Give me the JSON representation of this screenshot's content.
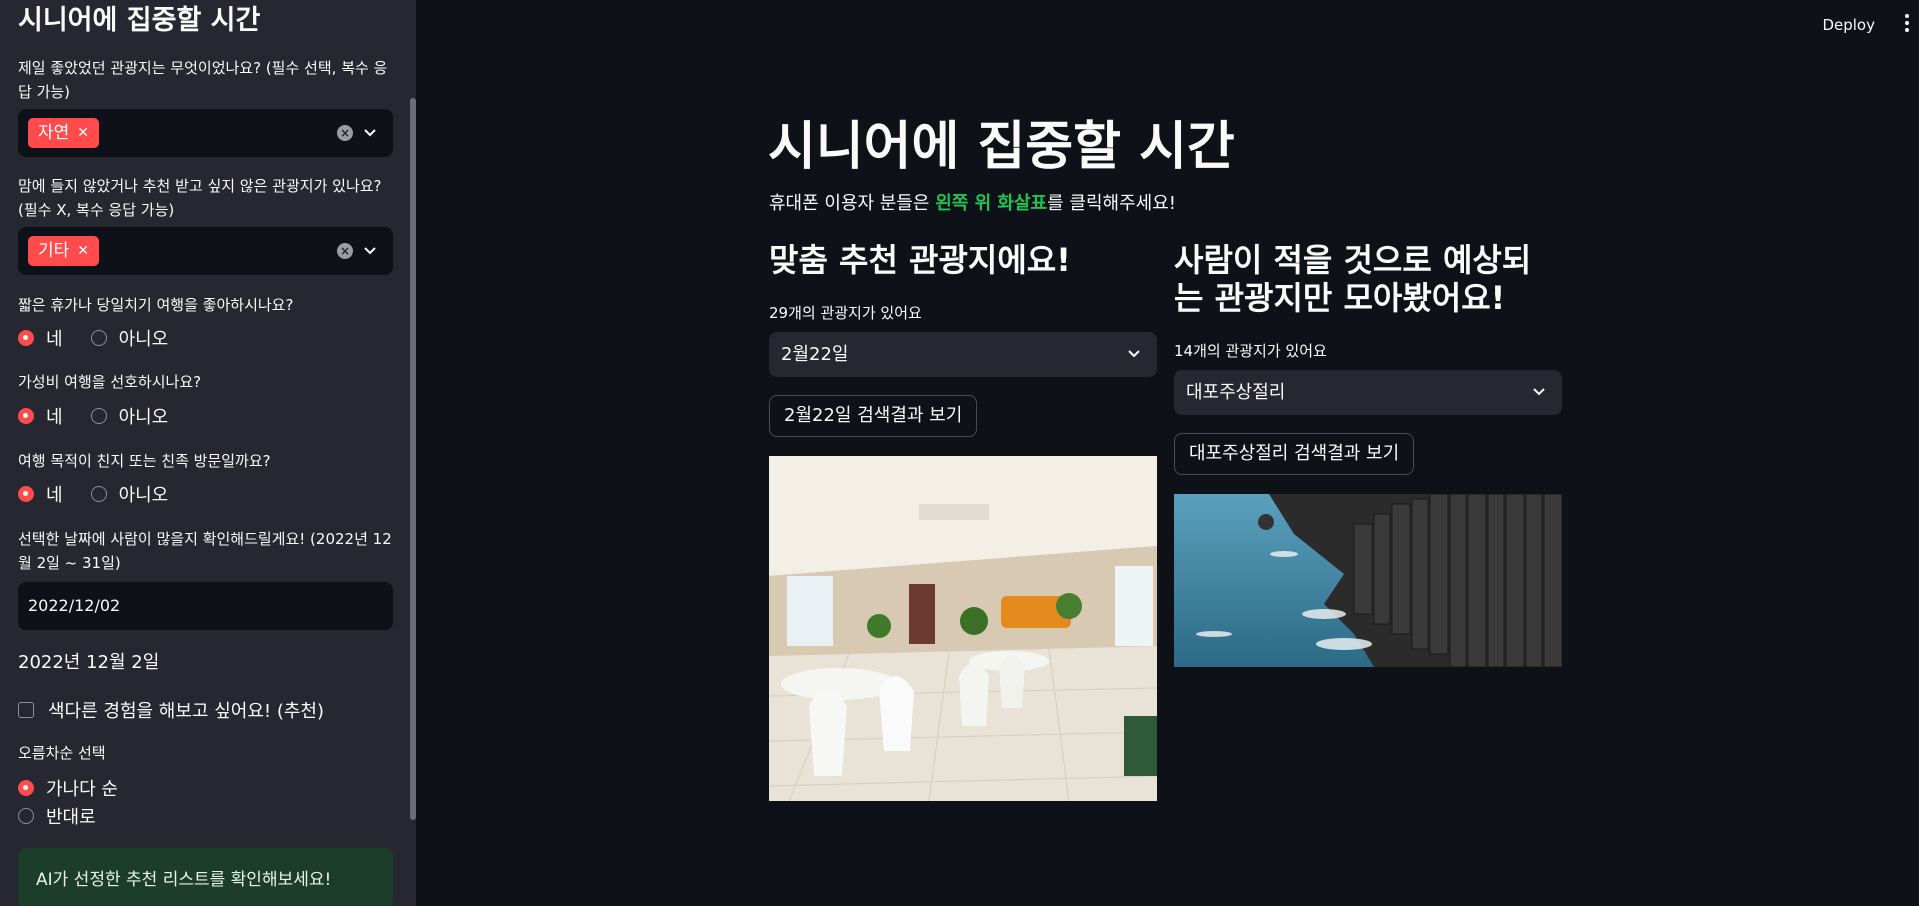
{
  "sidebar": {
    "title": "시니어에 집중할 시간",
    "q1": {
      "label": "제일 좋았었던 관광지는 무엇이었나요? (필수 선택, 복수 응답 가능)",
      "tag": "자연"
    },
    "q2": {
      "label": "맘에 들지 않았거나 추천 받고 싶지 않은 관광지가 있나요? (필수 X, 복수 응답 가능)",
      "tag": "기타"
    },
    "q3": {
      "label": "짧은 휴가나 당일치기 여행을 좋아하시나요?",
      "yes": "네",
      "no": "아니오",
      "selected": "네"
    },
    "q4": {
      "label": "가성비 여행을 선호하시나요?",
      "yes": "네",
      "no": "아니오",
      "selected": "네"
    },
    "q5": {
      "label": "여행 목적이 친지 또는 친족 방문일까요?",
      "yes": "네",
      "no": "아니오",
      "selected": "네"
    },
    "date": {
      "label": "선택한 날짜에 사람이 많을지 확인해드릴게요! (2022년 12월 2일 ~ 31일)",
      "value": "2022/12/02",
      "display": "2022년 12월 2일"
    },
    "checkbox_label": "색다른 경험을 해보고 싶어요! (추천)",
    "sort": {
      "label": "오름차순 선택",
      "opt1": "가나다 순",
      "opt2": "반대로",
      "selected": "가나다 순"
    },
    "info": "AI가 선정한 추천 리스트를 확인해보세요!"
  },
  "header": {
    "deploy": "Deploy"
  },
  "main": {
    "title": "시니어에 집중할 시간",
    "intro_pre": "휴대폰 이용자 분들은 ",
    "intro_hl": "왼쪽 위 화살표",
    "intro_post": "를 클릭해주세요!",
    "left": {
      "title": "맞춤 추천 관광지에요!",
      "count": "29개의 관광지가 있어요",
      "select": "2월22일",
      "button": "2월22일 검색결과 보기",
      "image": "cafe-interior"
    },
    "right": {
      "title_line1": "사람이 적을 것으로 예상되",
      "title_line2": "는 관광지만 모아봤어요!",
      "count": "14개의 관광지가 있어요",
      "select": "대포주상절리",
      "button": "대포주상절리 검색결과 보기",
      "image": "basalt-cliff-coast"
    }
  },
  "colors": {
    "accent": "#ff4b4b",
    "highlight": "#21c354",
    "bg": "#0e1117",
    "sidebar": "#262730"
  }
}
